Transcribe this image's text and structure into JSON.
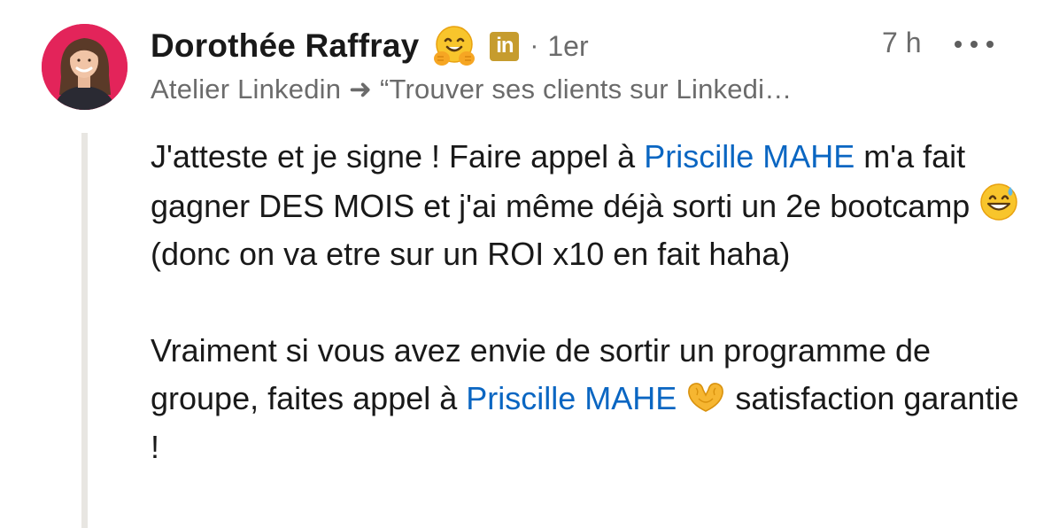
{
  "comment": {
    "author": {
      "name": "Dorothée Raffray",
      "emoji_icon": "hugging-face-icon",
      "badge_icon": "linkedin-badge-icon",
      "badge_text": "in",
      "separator": "·",
      "degree": "1er",
      "headline": "Atelier Linkedin ➜ “Trouver ses clients sur Linkedi…"
    },
    "time": "7 h",
    "more_icon": "more-options-icon",
    "body": {
      "p1_a": "J'atteste et je signe ! Faire appel à ",
      "mention_1": "Priscille MAHE",
      "p1_b": " m'a fait gagner DES MOIS et j'ai même déjà sorti un 2e bootcamp ",
      "emoji_1": "grinning-sweat-face-icon",
      "p1_c": "  (donc on va etre sur un ROI x10 en fait haha)",
      "p2_a": "Vraiment si vous avez envie de sortir un programme de groupe, faites appel à ",
      "mention_2": "Priscille MAHE",
      "emoji_2": "heart-hands-icon",
      "p2_b": " satisfaction garantie !"
    }
  },
  "colors": {
    "mention": "#0a66c2",
    "text": "#191919",
    "muted": "#6b6b6b",
    "avatar_bg": "#e3245a",
    "badge": "#c69c2e",
    "thread_line": "#e8e6e2"
  }
}
